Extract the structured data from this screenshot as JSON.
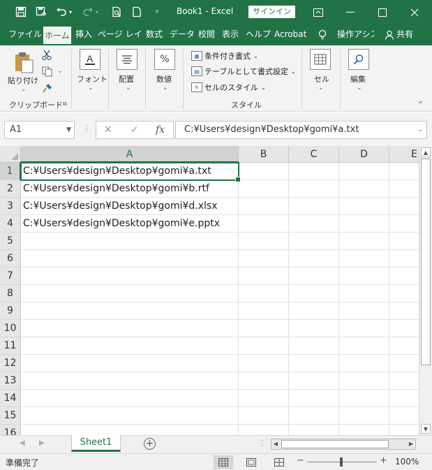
{
  "titlebar": {
    "title": "Book1 - Excel",
    "signin_label": "サインイン",
    "icons": [
      "save-icon",
      "autosave-icon",
      "undo-icon",
      "redo-icon",
      "print-preview-icon",
      "new-file-icon",
      "customize-qat-icon"
    ],
    "window_controls": [
      "ribbon-display-icon",
      "minimize-icon",
      "maximize-icon",
      "close-icon"
    ]
  },
  "tabs": [
    {
      "label": "ファイル",
      "active": false
    },
    {
      "label": "ホーム",
      "active": true
    },
    {
      "label": "挿入",
      "active": false
    },
    {
      "label": "ページ レイア",
      "active": false
    },
    {
      "label": "数式",
      "active": false
    },
    {
      "label": "データ",
      "active": false
    },
    {
      "label": "校閲",
      "active": false
    },
    {
      "label": "表示",
      "active": false
    },
    {
      "label": "ヘルプ",
      "active": false
    },
    {
      "label": "Acrobat",
      "active": false
    }
  ],
  "tell_me": "操作アシス",
  "share": "共有",
  "ribbon": {
    "clipboard": {
      "paste": "貼り付け",
      "group": "クリップボード"
    },
    "font": "フォント",
    "alignment": "配置",
    "number": "数値",
    "styles": {
      "conditional": "条件付き書式",
      "table": "テーブルとして書式設定",
      "cell_styles": "セルのスタイル",
      "group": "スタイル"
    },
    "cells": "セル",
    "editing": "編集"
  },
  "formula_bar": {
    "name_box": "A1",
    "formula": "C:¥Users¥design¥Desktop¥gomi¥a.txt"
  },
  "grid": {
    "columns": [
      "A",
      "B",
      "C",
      "D",
      "E"
    ],
    "rows": [
      "1",
      "2",
      "3",
      "4",
      "5",
      "6",
      "7",
      "8",
      "9",
      "10",
      "11",
      "12",
      "13",
      "14",
      "15",
      "16"
    ],
    "cells": [
      "C:¥Users¥design¥Desktop¥gomi¥a.txt",
      "C:¥Users¥design¥Desktop¥gomi¥b.rtf",
      "C:¥Users¥design¥Desktop¥gomi¥d.xlsx",
      "C:¥Users¥design¥Desktop¥gomi¥e.pptx"
    ],
    "selected": "A1"
  },
  "sheets": [
    {
      "label": "Sheet1",
      "active": true
    }
  ],
  "status": {
    "text": "準備完了",
    "zoom": "100%"
  },
  "colors": {
    "accent": "#217346"
  }
}
